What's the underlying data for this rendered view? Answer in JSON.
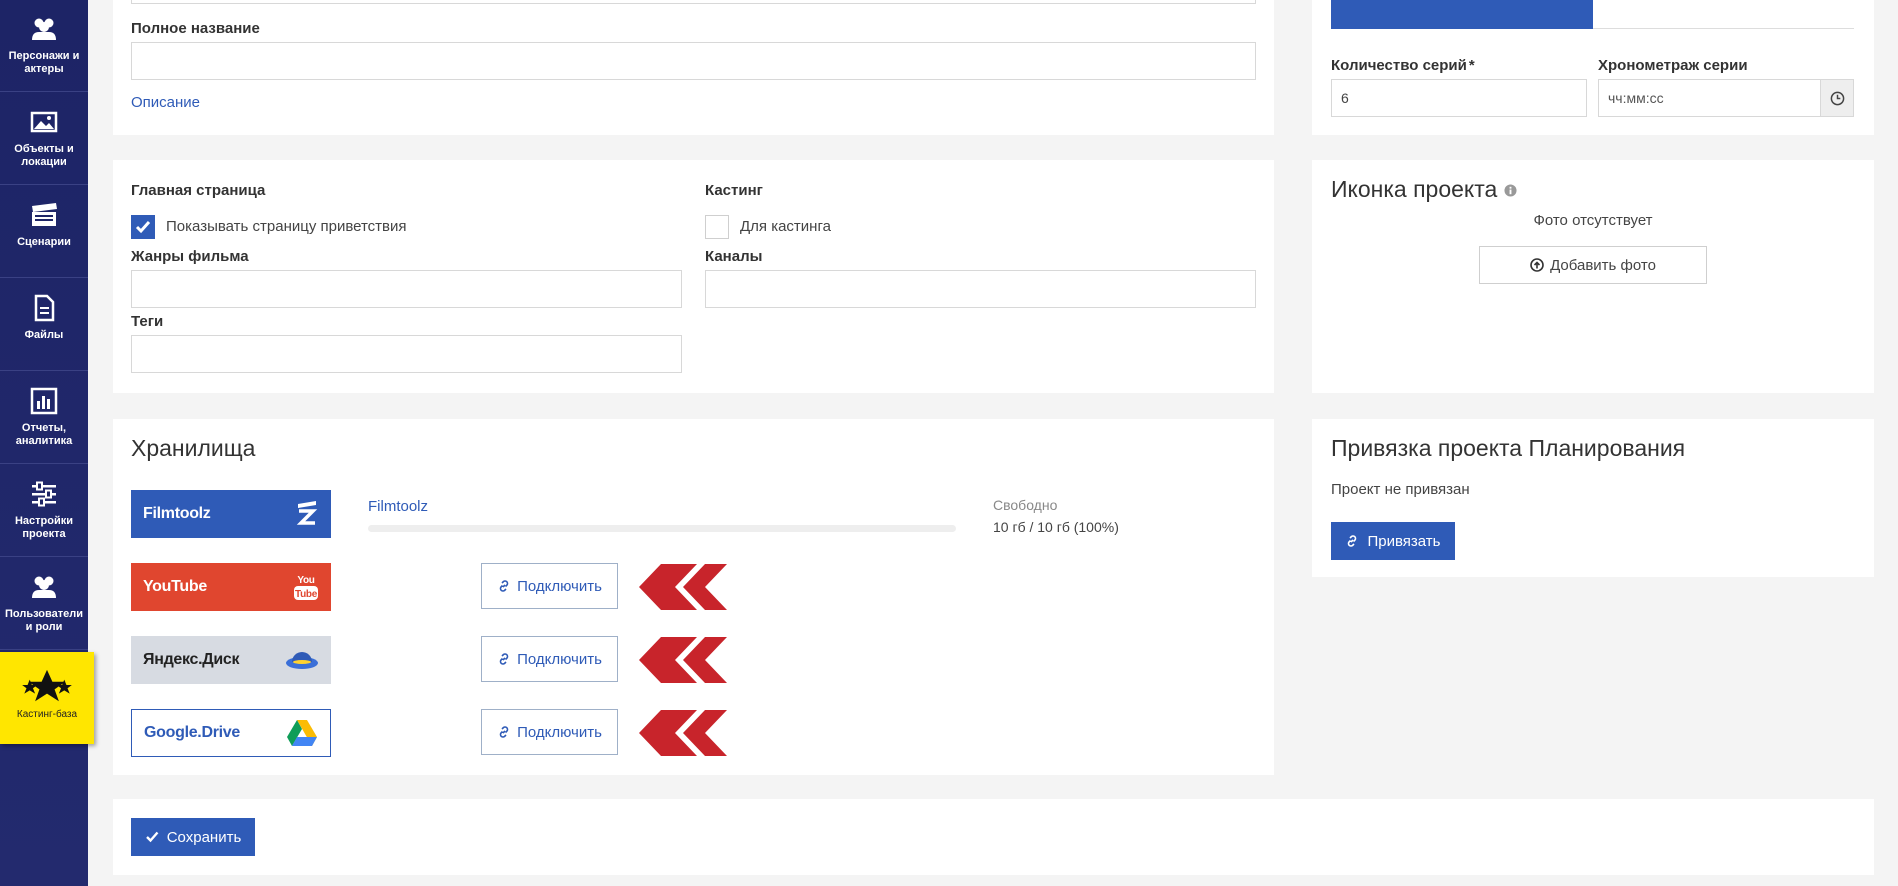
{
  "sidebar": {
    "items": [
      {
        "label": "Персонажи и актеры",
        "icon": "people-icon"
      },
      {
        "label": "Объекты и локации",
        "icon": "image-icon"
      },
      {
        "label": "Сценарии",
        "icon": "clapperboard-icon"
      },
      {
        "label": "Файлы",
        "icon": "file-icon"
      },
      {
        "label": "Отчеты, аналитика",
        "icon": "bar-chart-icon"
      },
      {
        "label": "Настройки проекта",
        "icon": "sliders-icon"
      },
      {
        "label": "Пользователи и роли",
        "icon": "users-icon"
      },
      {
        "label": "Кастинг-база",
        "icon": "stars-icon"
      }
    ]
  },
  "basic": {
    "full_name_label": "Полное название",
    "full_name_value": "",
    "description_link": "Описание"
  },
  "series": {
    "count_label": "Количество серий",
    "required_mark": "*",
    "count_value": "6",
    "duration_label": "Хронометраж серии",
    "duration_placeholder": "чч:мм:сс"
  },
  "settings": {
    "home_label": "Главная страница",
    "show_welcome_label": "Показывать страницу приветствия",
    "show_welcome_checked": true,
    "casting_label": "Кастинг",
    "for_casting_label": "Для кастинга",
    "for_casting_checked": false,
    "genres_label": "Жанры фильма",
    "channels_label": "Каналы",
    "tags_label": "Теги"
  },
  "icon_panel": {
    "title": "Иконка проекта",
    "no_photo": "Фото отсутствует",
    "add_photo": "Добавить фото"
  },
  "storage": {
    "title": "Хранилища",
    "services": [
      {
        "name": "Filmtoolz",
        "color": "#2f5bb7"
      },
      {
        "name": "YouTube",
        "color": "#e0462f"
      },
      {
        "name": "Яндекс.Диск",
        "color": "#d7dbe2"
      },
      {
        "name": "Google.Drive",
        "color": "#ffffff"
      }
    ],
    "filmtoolz_link": "Filmtoolz",
    "free_label": "Свободно",
    "free_value": "10 гб / 10 гб (100%)",
    "usage_fraction": 0.0,
    "connect_label": "Подключить"
  },
  "planning": {
    "title": "Привязка проекта Планирования",
    "status": "Проект не привязан",
    "bind_label": "Привязать"
  },
  "save_label": "Сохранить",
  "colors": {
    "primary": "#2f5bb7",
    "sidebar": "#1d2466",
    "casting_accent": "#ffe600",
    "arrow_red": "#c8242b"
  }
}
